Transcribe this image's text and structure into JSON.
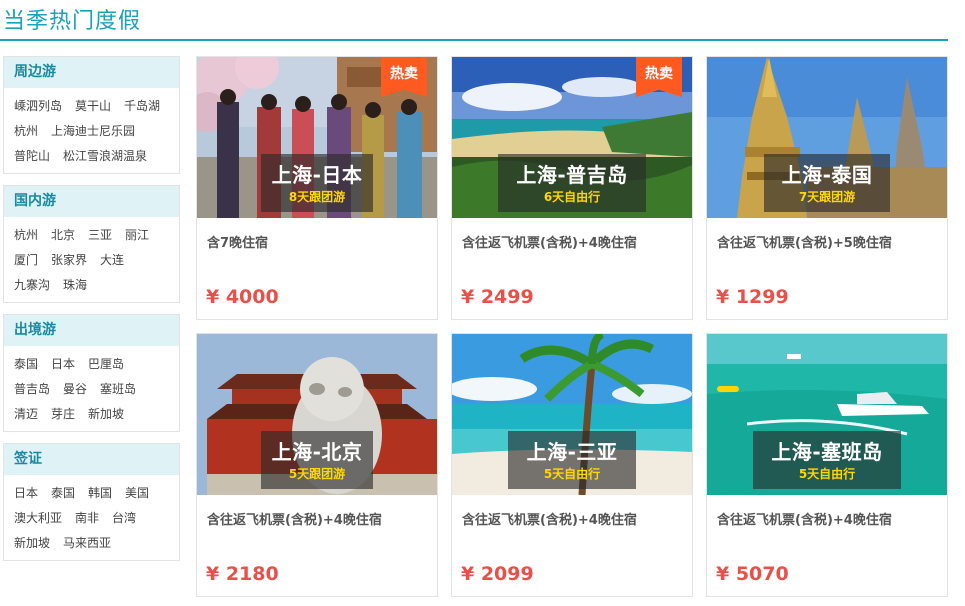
{
  "page": {
    "title": "当季热门度假"
  },
  "sidebar": {
    "categories": [
      {
        "title": "周边游",
        "links": [
          "嵊泗列岛",
          "莫干山",
          "千岛湖",
          "杭州",
          "上海迪士尼乐园",
          "普陀山",
          "松江雪浪湖温泉"
        ]
      },
      {
        "title": "国内游",
        "links": [
          "杭州",
          "北京",
          "三亚",
          "丽江",
          "厦门",
          "张家界",
          "大连",
          "九寨沟",
          "珠海"
        ]
      },
      {
        "title": "出境游",
        "links": [
          "泰国",
          "日本",
          "巴厘岛",
          "普吉岛",
          "曼谷",
          "塞班岛",
          "清迈",
          "芽庄",
          "新加坡"
        ]
      },
      {
        "title": "签证",
        "links": [
          "日本",
          "泰国",
          "韩国",
          "美国",
          "澳大利亚",
          "南非",
          "台湾",
          "新加坡",
          "马来西亚"
        ]
      }
    ]
  },
  "products": [
    {
      "dest": "上海-日本",
      "trip": "8天跟团游",
      "desc": "含7晚住宿",
      "price": "¥ 4000",
      "badge": "热卖"
    },
    {
      "dest": "上海-普吉岛",
      "trip": "6天自由行",
      "desc": "含往返飞机票(含税)+4晚住宿",
      "price": "¥ 2499",
      "badge": "热卖"
    },
    {
      "dest": "上海-泰国",
      "trip": "7天跟团游",
      "desc": "含往返飞机票(含税)+5晚住宿",
      "price": "¥ 1299",
      "badge": ""
    },
    {
      "dest": "上海-北京",
      "trip": "5天跟团游",
      "desc": "含往返飞机票(含税)+4晚住宿",
      "price": "¥ 2180",
      "badge": ""
    },
    {
      "dest": "上海-三亚",
      "trip": "5天自由行",
      "desc": "含往返飞机票(含税)+4晚住宿",
      "price": "¥ 2099",
      "badge": ""
    },
    {
      "dest": "上海-塞班岛",
      "trip": "5天自由行",
      "desc": "含往返飞机票(含税)+4晚住宿",
      "price": "¥ 5070",
      "badge": ""
    }
  ],
  "theme": {
    "accent": "#1aa3b8",
    "price": "#e8504a",
    "badge": "#ff5a1f",
    "trip_highlight": "#ffd800"
  }
}
